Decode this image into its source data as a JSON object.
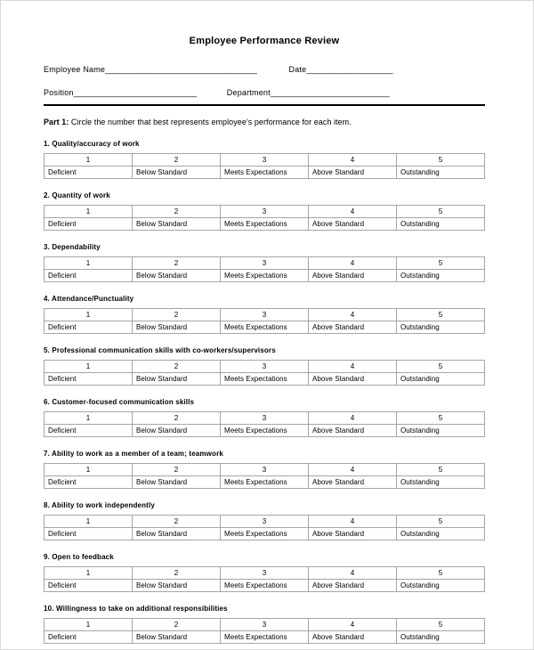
{
  "document": {
    "title": "Employee Performance Review"
  },
  "header_fields": {
    "row1": [
      {
        "label": "Employee Name",
        "blank": "_____________________________________"
      },
      {
        "label": "Date",
        "blank": "_____________________"
      }
    ],
    "row2": [
      {
        "label": "Position",
        "blank": "______________________________"
      },
      {
        "label": "Department",
        "blank": "_____________________________"
      }
    ]
  },
  "instructions": {
    "part_label": "Part 1:",
    "text": " Circle the number that best represents employee’s performance for each item."
  },
  "rating_scale": {
    "scores": [
      "1",
      "2",
      "3",
      "4",
      "5"
    ],
    "labels": [
      "Deficient",
      "Below Standard",
      "Meets Expectations",
      "Above Standard",
      "Outstanding"
    ]
  },
  "items": [
    {
      "number": "1.",
      "heading": "1. Quality/accuracy of work"
    },
    {
      "number": "2.",
      "heading": "2. Quantity of work"
    },
    {
      "number": "3.",
      "heading": "3. Dependability"
    },
    {
      "number": "4.",
      "heading": "4. Attendance/Punctuality"
    },
    {
      "number": "5.",
      "heading": "5. Professional communication skills with co-workers/supervisors"
    },
    {
      "number": "6.",
      "heading": "6. Customer-focused communication skills"
    },
    {
      "number": "7.",
      "heading": "7. Ability to work as a member of a team; teamwork"
    },
    {
      "number": "8.",
      "heading": "8. Ability to work independently"
    },
    {
      "number": "9.",
      "heading": "9. Open to feedback"
    },
    {
      "number": "10.",
      "heading": "10. Willingness to take on additional responsibilities"
    }
  ],
  "colors": {
    "page_background": "#ffffff",
    "text": "#000000",
    "page_border": "#d9d9d9",
    "table_border": "#a6a6a6",
    "rule": "#000000"
  }
}
